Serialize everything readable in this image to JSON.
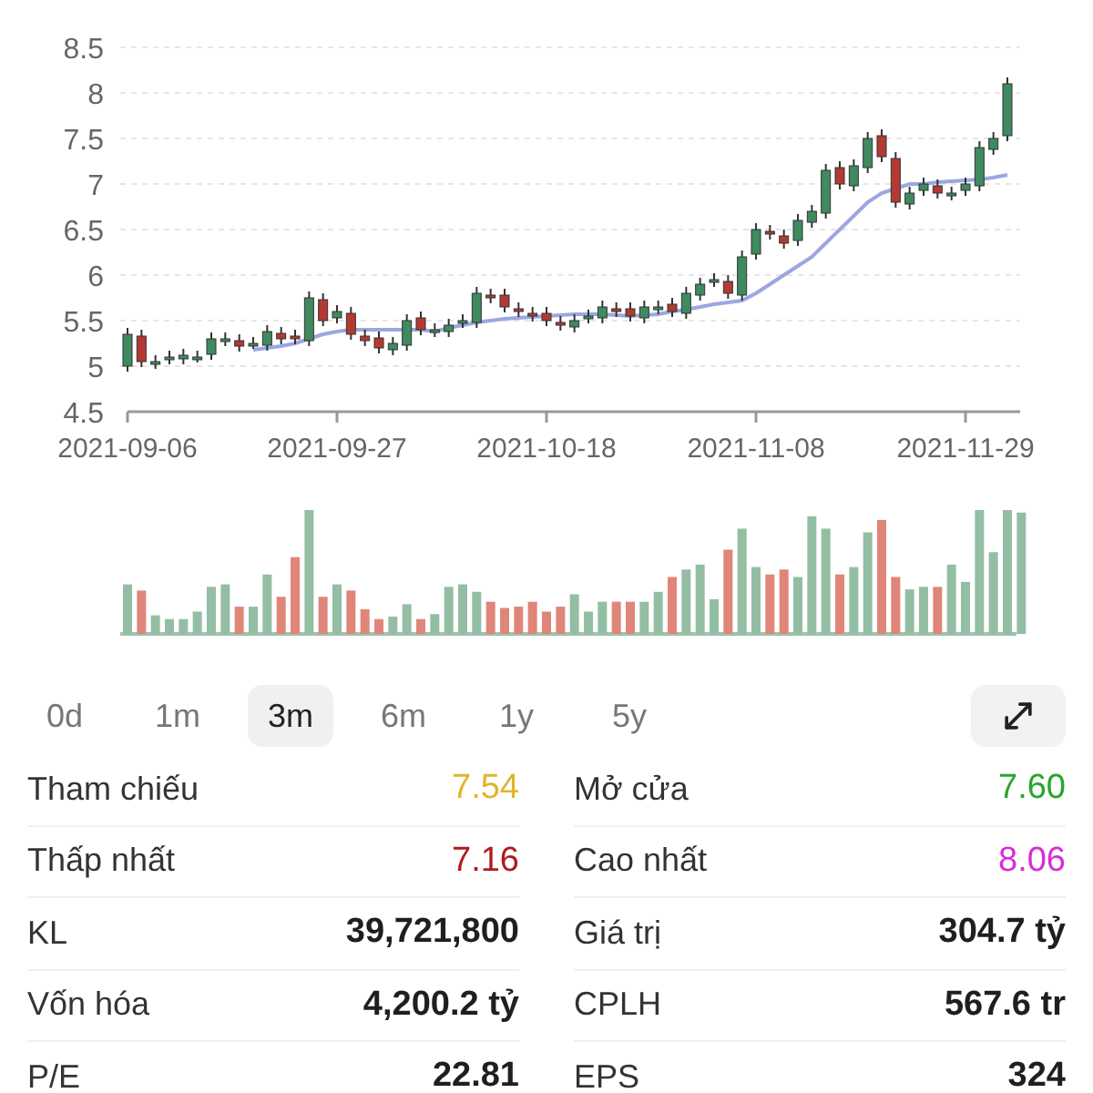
{
  "price_chart": {
    "chart_data": {
      "type": "candlestick",
      "grid": true,
      "yticks": [
        8.5,
        8,
        7.5,
        7,
        6.5,
        6,
        5.5,
        5,
        4.5
      ],
      "ylim": [
        4.5,
        8.5
      ],
      "categories": [
        "2021-09-06",
        null,
        null,
        null,
        null,
        null,
        null,
        null,
        null,
        null,
        null,
        null,
        null,
        null,
        null,
        "2021-09-27",
        null,
        null,
        null,
        null,
        null,
        null,
        null,
        null,
        null,
        null,
        null,
        null,
        null,
        null,
        "2021-10-18",
        null,
        null,
        null,
        null,
        null,
        null,
        null,
        null,
        null,
        null,
        null,
        null,
        null,
        null,
        "2021-11-08",
        null,
        null,
        null,
        null,
        null,
        null,
        null,
        null,
        null,
        null,
        null,
        null,
        null,
        null,
        "2021-11-29",
        null,
        null,
        null
      ],
      "ohlc": [
        [
          5.0,
          5.42,
          4.94,
          5.35
        ],
        [
          5.33,
          5.4,
          4.99,
          5.05
        ],
        [
          5.03,
          5.12,
          4.97,
          5.05
        ],
        [
          5.08,
          5.17,
          5.02,
          5.1
        ],
        [
          5.08,
          5.19,
          5.02,
          5.12
        ],
        [
          5.1,
          5.17,
          5.04,
          5.1
        ],
        [
          5.13,
          5.37,
          5.07,
          5.3
        ],
        [
          5.28,
          5.37,
          5.22,
          5.3
        ],
        [
          5.28,
          5.35,
          5.16,
          5.22
        ],
        [
          5.25,
          5.32,
          5.19,
          5.25
        ],
        [
          5.23,
          5.45,
          5.17,
          5.38
        ],
        [
          5.36,
          5.43,
          5.24,
          5.3
        ],
        [
          5.33,
          5.4,
          5.24,
          5.3
        ],
        [
          5.28,
          5.82,
          5.22,
          5.75
        ],
        [
          5.73,
          5.8,
          5.44,
          5.5
        ],
        [
          5.53,
          5.67,
          5.47,
          5.6
        ],
        [
          5.58,
          5.65,
          5.29,
          5.35
        ],
        [
          5.33,
          5.4,
          5.22,
          5.28
        ],
        [
          5.31,
          5.38,
          5.14,
          5.2
        ],
        [
          5.18,
          5.32,
          5.12,
          5.25
        ],
        [
          5.23,
          5.57,
          5.17,
          5.5
        ],
        [
          5.53,
          5.6,
          5.34,
          5.4
        ],
        [
          5.38,
          5.47,
          5.32,
          5.4
        ],
        [
          5.38,
          5.52,
          5.32,
          5.45
        ],
        [
          5.48,
          5.57,
          5.42,
          5.5
        ],
        [
          5.48,
          5.87,
          5.42,
          5.8
        ],
        [
          5.78,
          5.85,
          5.69,
          5.75
        ],
        [
          5.78,
          5.85,
          5.59,
          5.65
        ],
        [
          5.63,
          5.7,
          5.54,
          5.6
        ],
        [
          5.58,
          5.65,
          5.49,
          5.55
        ],
        [
          5.58,
          5.65,
          5.44,
          5.5
        ],
        [
          5.48,
          5.55,
          5.39,
          5.45
        ],
        [
          5.43,
          5.57,
          5.37,
          5.5
        ],
        [
          5.53,
          5.62,
          5.47,
          5.55
        ],
        [
          5.53,
          5.72,
          5.47,
          5.65
        ],
        [
          5.63,
          5.7,
          5.54,
          5.6
        ],
        [
          5.63,
          5.7,
          5.49,
          5.55
        ],
        [
          5.53,
          5.72,
          5.47,
          5.65
        ],
        [
          5.63,
          5.72,
          5.57,
          5.65
        ],
        [
          5.68,
          5.75,
          5.54,
          5.6
        ],
        [
          5.58,
          5.87,
          5.52,
          5.8
        ],
        [
          5.78,
          5.97,
          5.72,
          5.9
        ],
        [
          5.93,
          6.02,
          5.87,
          5.95
        ],
        [
          5.93,
          6.0,
          5.74,
          5.8
        ],
        [
          5.78,
          6.27,
          5.72,
          6.2
        ],
        [
          6.23,
          6.57,
          6.17,
          6.5
        ],
        [
          6.48,
          6.55,
          6.39,
          6.45
        ],
        [
          6.43,
          6.5,
          6.29,
          6.35
        ],
        [
          6.38,
          6.67,
          6.32,
          6.6
        ],
        [
          6.58,
          6.77,
          6.52,
          6.7
        ],
        [
          6.68,
          7.22,
          6.62,
          7.15
        ],
        [
          7.18,
          7.25,
          6.94,
          7.0
        ],
        [
          6.98,
          7.27,
          6.92,
          7.2
        ],
        [
          7.18,
          7.57,
          7.12,
          7.5
        ],
        [
          7.53,
          7.6,
          7.24,
          7.3
        ],
        [
          7.28,
          7.35,
          6.74,
          6.8
        ],
        [
          6.78,
          6.97,
          6.72,
          6.9
        ],
        [
          6.93,
          7.07,
          6.87,
          7.0
        ],
        [
          6.98,
          7.05,
          6.84,
          6.9
        ],
        [
          6.88,
          6.97,
          6.82,
          6.9
        ],
        [
          6.93,
          7.07,
          6.87,
          7.0
        ],
        [
          6.98,
          7.47,
          6.92,
          7.4
        ],
        [
          7.38,
          7.57,
          7.32,
          7.5
        ],
        [
          7.53,
          8.17,
          7.47,
          8.1
        ]
      ],
      "series": [
        {
          "type": "line",
          "color": "#9ba7e0",
          "values": [
            null,
            null,
            null,
            null,
            null,
            null,
            null,
            null,
            null,
            5.18,
            5.2,
            5.22,
            5.25,
            5.3,
            5.35,
            5.38,
            5.4,
            5.4,
            5.4,
            5.4,
            5.4,
            5.4,
            5.38,
            5.42,
            5.45,
            5.48,
            5.5,
            5.52,
            5.53,
            5.54,
            5.55,
            5.56,
            5.57,
            5.57,
            5.57,
            5.56,
            5.55,
            5.56,
            5.57,
            5.6,
            5.62,
            5.65,
            5.68,
            5.7,
            5.72,
            5.8,
            5.9,
            6.0,
            6.1,
            6.2,
            6.35,
            6.5,
            6.65,
            6.8,
            6.9,
            6.95,
            7.0,
            7.0,
            7.02,
            7.03,
            7.04,
            7.05,
            7.07,
            7.1
          ]
        }
      ]
    }
  },
  "range_tabs": [
    {
      "label": "0d",
      "selected": false
    },
    {
      "label": "1m",
      "selected": false
    },
    {
      "label": "3m",
      "selected": true
    },
    {
      "label": "6m",
      "selected": false
    },
    {
      "label": "1y",
      "selected": false
    },
    {
      "label": "5y",
      "selected": false
    }
  ],
  "stats": [
    {
      "label": "Tham chiếu",
      "value": "7.54",
      "kind": "price",
      "color": "#e0b52a"
    },
    {
      "label": "Mở cửa",
      "value": "7.60",
      "kind": "price",
      "color": "#2aa52a"
    },
    {
      "label": "Thấp nhất",
      "value": "7.16",
      "kind": "price",
      "color": "#b01a1e"
    },
    {
      "label": "Cao nhất",
      "value": "8.06",
      "kind": "price",
      "color": "#d52fd5"
    },
    {
      "label": "KL",
      "value": "39,721,800",
      "kind": "figure",
      "color": "#1f1f1f"
    },
    {
      "label": "Giá trị",
      "value": "304.7 tỷ",
      "kind": "figure",
      "color": "#1f1f1f"
    },
    {
      "label": "Vốn hóa",
      "value": "4,200.2 tỷ",
      "kind": "figure",
      "color": "#1f1f1f"
    },
    {
      "label": "CPLH",
      "value": "567.6 tr",
      "kind": "figure",
      "color": "#1f1f1f"
    },
    {
      "label": "P/E",
      "value": "22.81",
      "kind": "figure",
      "color": "#1f1f1f"
    },
    {
      "label": "EPS",
      "value": "324",
      "kind": "figure",
      "color": "#1f1f1f"
    }
  ]
}
